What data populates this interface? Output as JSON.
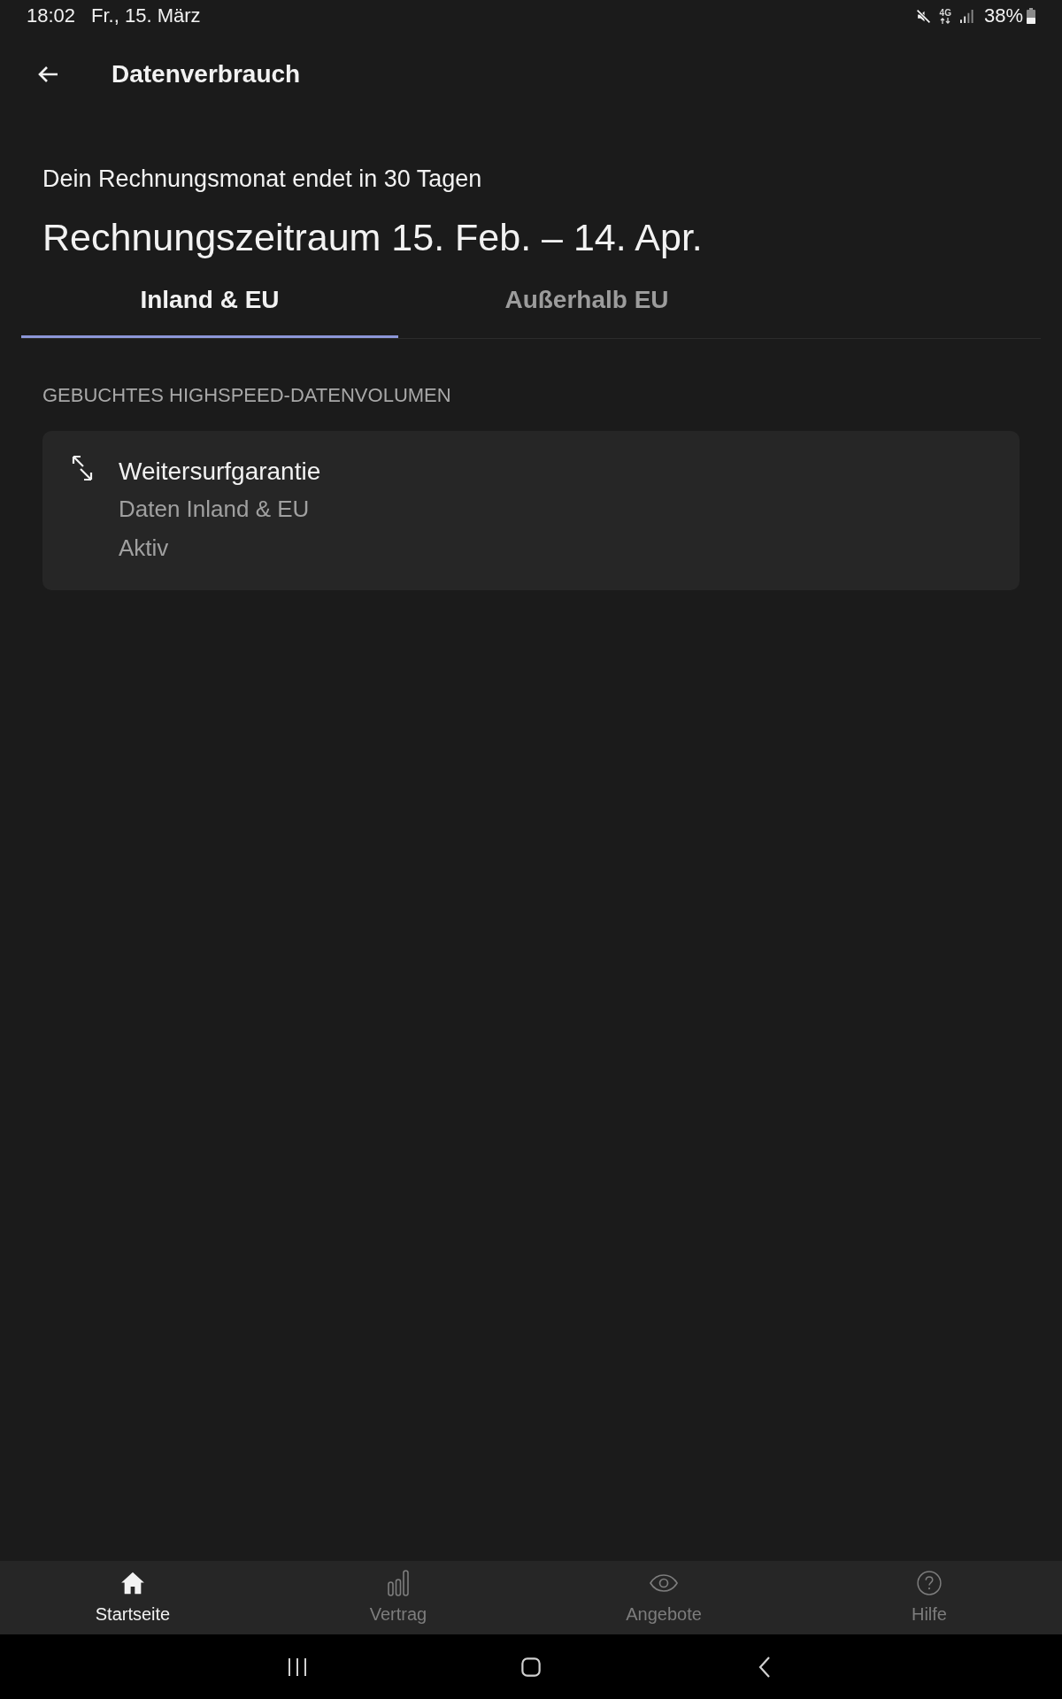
{
  "status_bar": {
    "time": "18:02",
    "date": "Fr., 15. März",
    "network_type": "4G",
    "battery": "38%"
  },
  "header": {
    "title": "Datenverbrauch"
  },
  "billing": {
    "notice": "Dein Rechnungsmonat endet in 30 Tagen",
    "period": "Rechnungszeitraum 15. Feb. – 14. Apr."
  },
  "tabs": [
    {
      "label": "Inland & EU",
      "selected": true
    },
    {
      "label": "Außerhalb EU",
      "selected": false
    }
  ],
  "section": {
    "heading": "GEBUCHTES HIGHSPEED-DATENVOLUMEN",
    "items": [
      {
        "title": "Weitersurfgarantie",
        "subtitle": "Daten Inland & EU",
        "status": "Aktiv"
      }
    ]
  },
  "bottom_nav": [
    {
      "kind": "home",
      "label": "Startseite",
      "selected": true
    },
    {
      "kind": "bars",
      "label": "Vertrag",
      "selected": false
    },
    {
      "kind": "eye",
      "label": "Angebote",
      "selected": false
    },
    {
      "kind": "help",
      "label": "Hilfe",
      "selected": false
    }
  ]
}
